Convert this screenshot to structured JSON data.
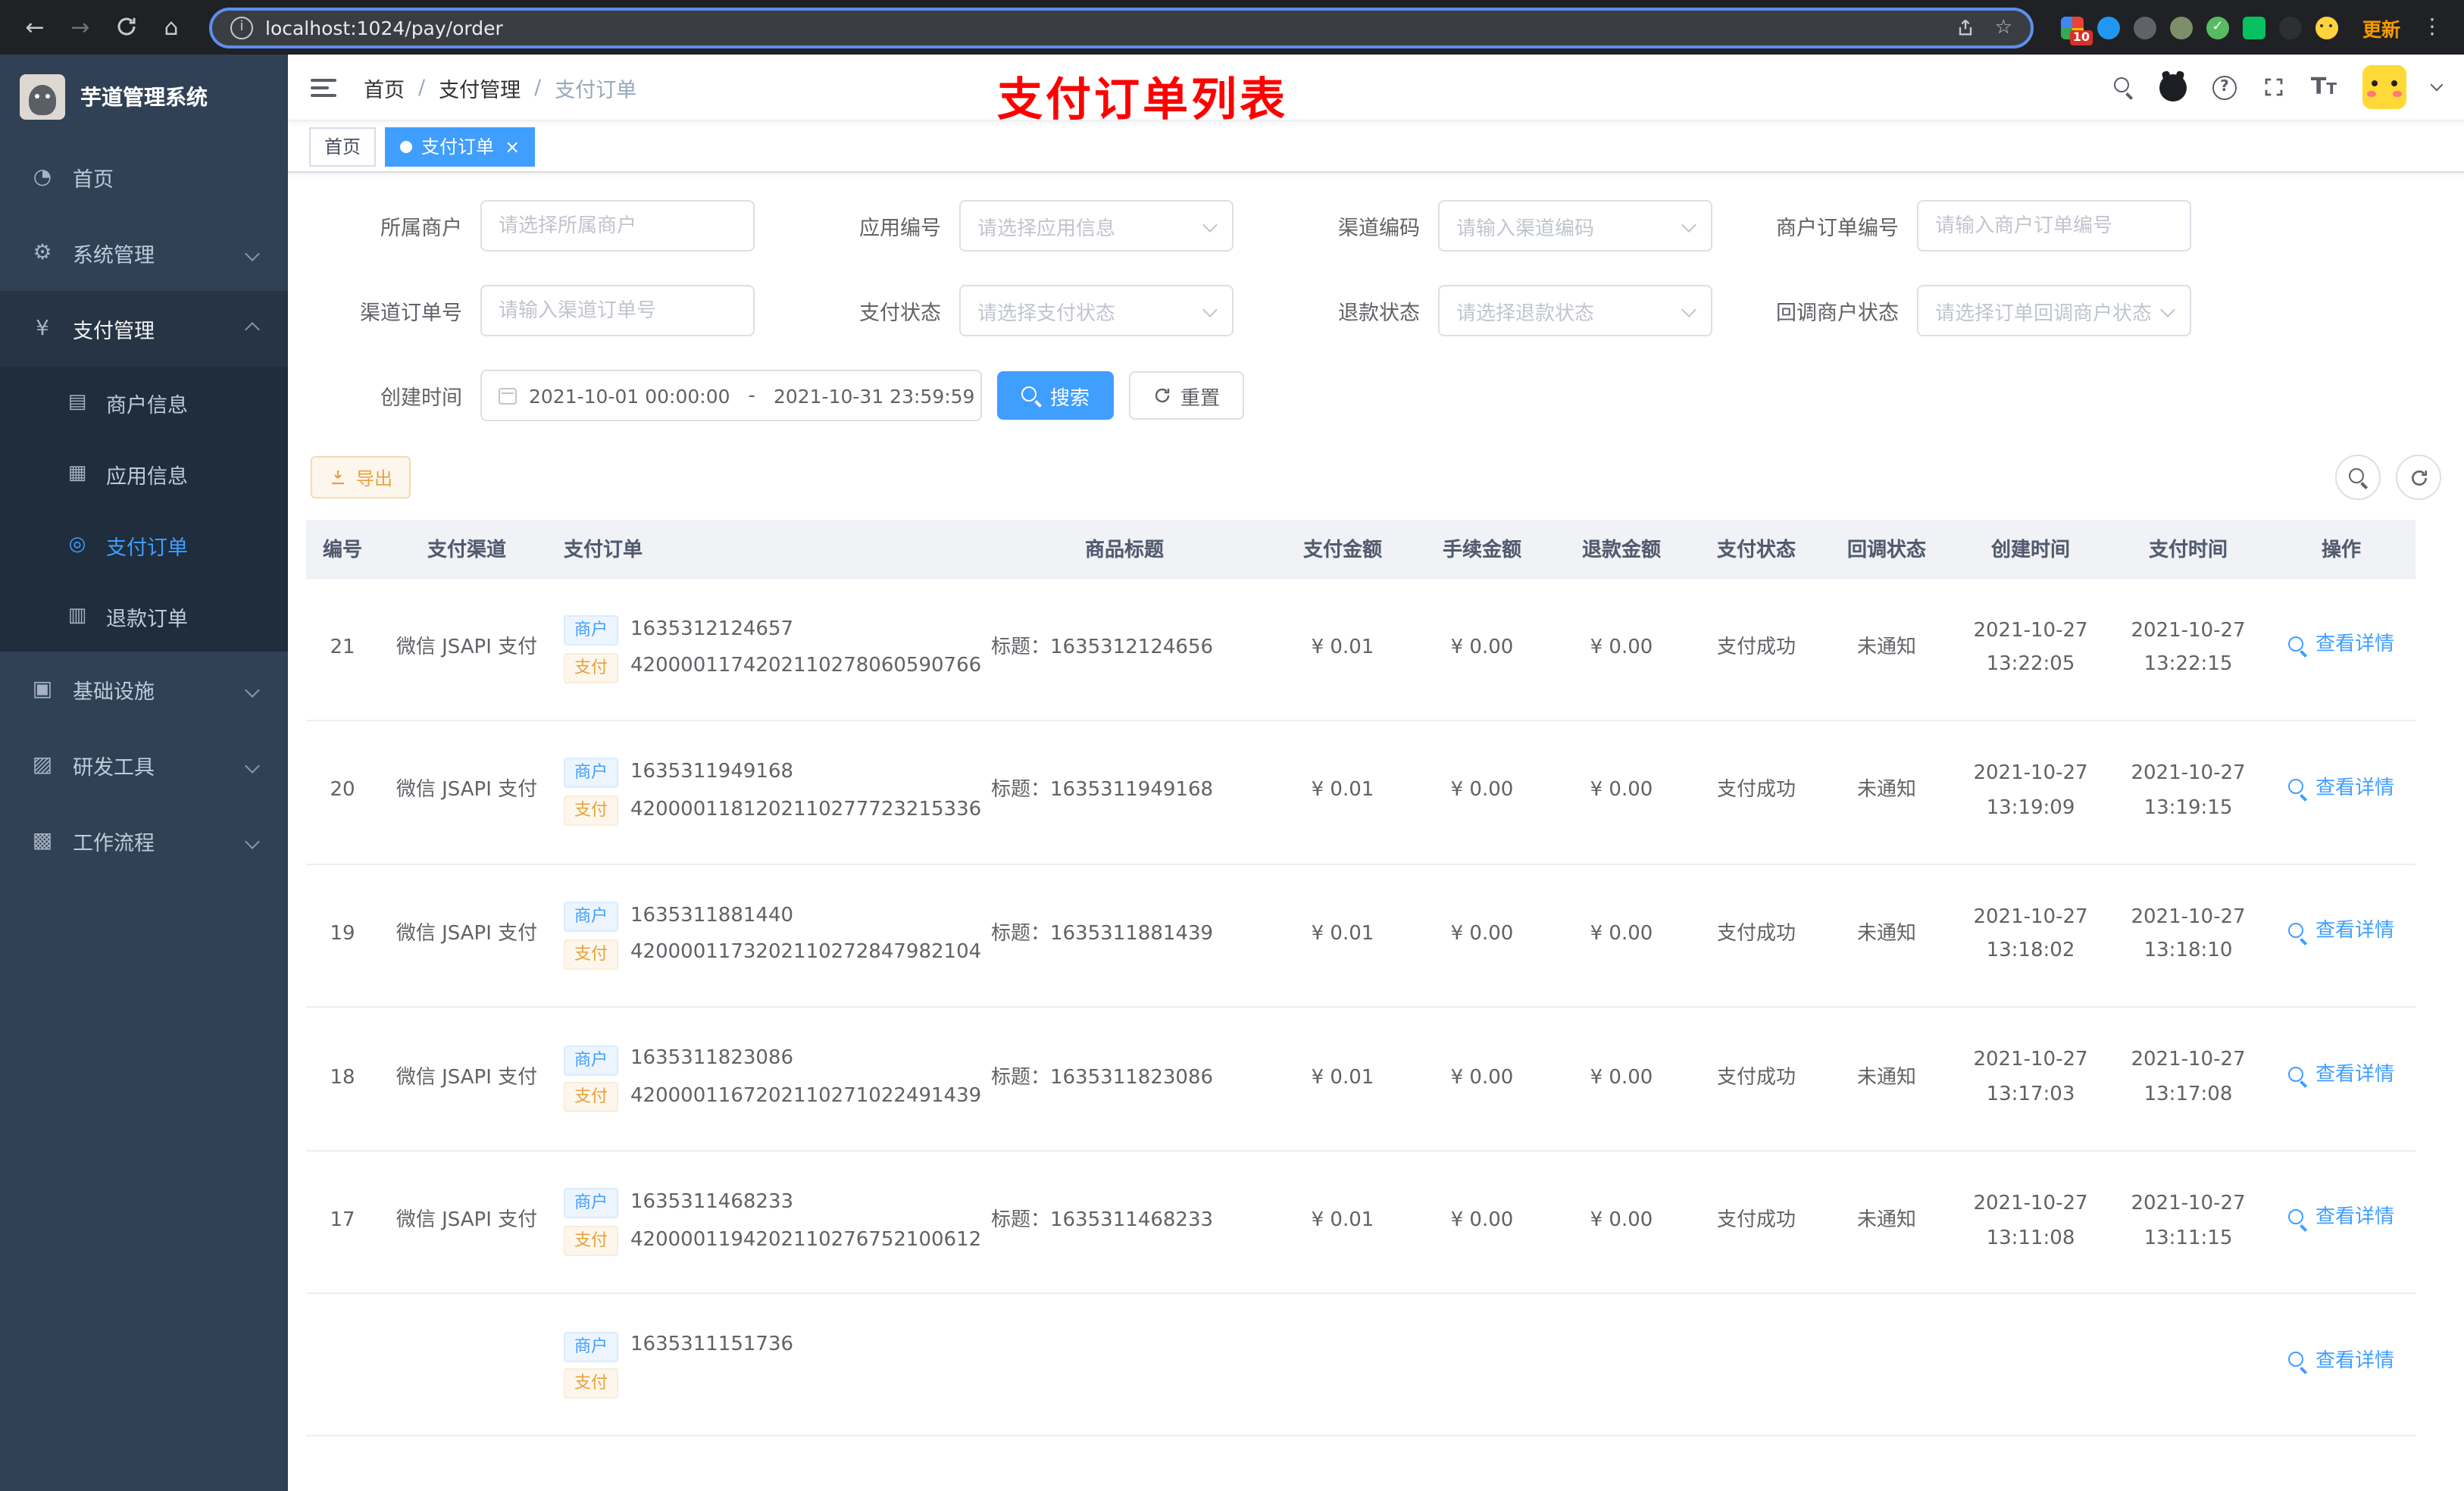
{
  "browser": {
    "url": "localhost:1024/pay/order",
    "update_label": "更新",
    "extension_badge": "10"
  },
  "sidebar": {
    "logo_title": "芋道管理系统",
    "items_top": [
      {
        "label": "首页"
      },
      {
        "label": "系统管理"
      },
      {
        "label": "支付管理"
      }
    ],
    "submenu": [
      {
        "label": "商户信息"
      },
      {
        "label": "应用信息"
      },
      {
        "label": "支付订单"
      },
      {
        "label": "退款订单"
      }
    ],
    "items_bottom": [
      {
        "label": "基础设施"
      },
      {
        "label": "研发工具"
      },
      {
        "label": "工作流程"
      }
    ]
  },
  "header": {
    "breadcrumb": [
      "首页",
      "支付管理",
      "支付订单"
    ],
    "annotation": "支付订单列表"
  },
  "tabs": [
    {
      "label": "首页"
    },
    {
      "label": "支付订单"
    }
  ],
  "filters": {
    "row1": [
      {
        "label": "所属商户",
        "placeholder": "请选择所属商户"
      },
      {
        "label": "应用编号",
        "placeholder": "请选择应用信息"
      },
      {
        "label": "渠道编码",
        "placeholder": "请输入渠道编码"
      },
      {
        "label": "商户订单编号",
        "placeholder": "请输入商户订单编号"
      }
    ],
    "row2": [
      {
        "label": "渠道订单号",
        "placeholder": "请输入渠道订单号"
      },
      {
        "label": "支付状态",
        "placeholder": "请选择支付状态"
      },
      {
        "label": "退款状态",
        "placeholder": "请选择退款状态"
      },
      {
        "label": "回调商户状态",
        "placeholder": "请选择订单回调商户状态"
      }
    ],
    "date_label": "创建时间",
    "date_start": "2021-10-01 00:00:00",
    "date_sep": "-",
    "date_end": "2021-10-31 23:59:59",
    "search_label": "搜索",
    "reset_label": "重置"
  },
  "toolbar": {
    "export_label": "导出"
  },
  "table": {
    "columns": [
      "编号",
      "支付渠道",
      "支付订单",
      "商品标题",
      "支付金额",
      "手续金额",
      "退款金额",
      "支付状态",
      "回调状态",
      "创建时间",
      "支付时间",
      "操作"
    ],
    "merchant_tag": "商户",
    "pay_tag": "支付",
    "action_label": "查看详情",
    "rows": [
      {
        "id": "21",
        "channel": "微信 JSAPI 支付",
        "merchant_no": "1635312124657",
        "pay_no": "4200001174202110278060590766",
        "title": "标题：1635312124656",
        "amount": "¥ 0.01",
        "fee": "¥ 0.00",
        "refund": "¥ 0.00",
        "status": "支付成功",
        "callback": "未通知",
        "create_time": "2021-10-27 13:22:05",
        "pay_time": "2021-10-27 13:22:15"
      },
      {
        "id": "20",
        "channel": "微信 JSAPI 支付",
        "merchant_no": "1635311949168",
        "pay_no": "4200001181202110277723215336",
        "title": "标题：1635311949168",
        "amount": "¥ 0.01",
        "fee": "¥ 0.00",
        "refund": "¥ 0.00",
        "status": "支付成功",
        "callback": "未通知",
        "create_time": "2021-10-27 13:19:09",
        "pay_time": "2021-10-27 13:19:15"
      },
      {
        "id": "19",
        "channel": "微信 JSAPI 支付",
        "merchant_no": "1635311881440",
        "pay_no": "4200001173202110272847982104",
        "title": "标题：1635311881439",
        "amount": "¥ 0.01",
        "fee": "¥ 0.00",
        "refund": "¥ 0.00",
        "status": "支付成功",
        "callback": "未通知",
        "create_time": "2021-10-27 13:18:02",
        "pay_time": "2021-10-27 13:18:10"
      },
      {
        "id": "18",
        "channel": "微信 JSAPI 支付",
        "merchant_no": "1635311823086",
        "pay_no": "4200001167202110271022491439",
        "title": "标题：1635311823086",
        "amount": "¥ 0.01",
        "fee": "¥ 0.00",
        "refund": "¥ 0.00",
        "status": "支付成功",
        "callback": "未通知",
        "create_time": "2021-10-27 13:17:03",
        "pay_time": "2021-10-27 13:17:08"
      },
      {
        "id": "17",
        "channel": "微信 JSAPI 支付",
        "merchant_no": "1635311468233",
        "pay_no": "4200001194202110276752100612",
        "title": "标题：1635311468233",
        "amount": "¥ 0.01",
        "fee": "¥ 0.00",
        "refund": "¥ 0.00",
        "status": "支付成功",
        "callback": "未通知",
        "create_time": "2021-10-27 13:11:08",
        "pay_time": "2021-10-27 13:11:15"
      },
      {
        "id": "",
        "channel": "",
        "merchant_no": "1635311151736",
        "pay_no": "",
        "title": "",
        "amount": "",
        "fee": "",
        "refund": "",
        "status": "",
        "callback": "",
        "create_time": "",
        "pay_time": ""
      }
    ]
  }
}
